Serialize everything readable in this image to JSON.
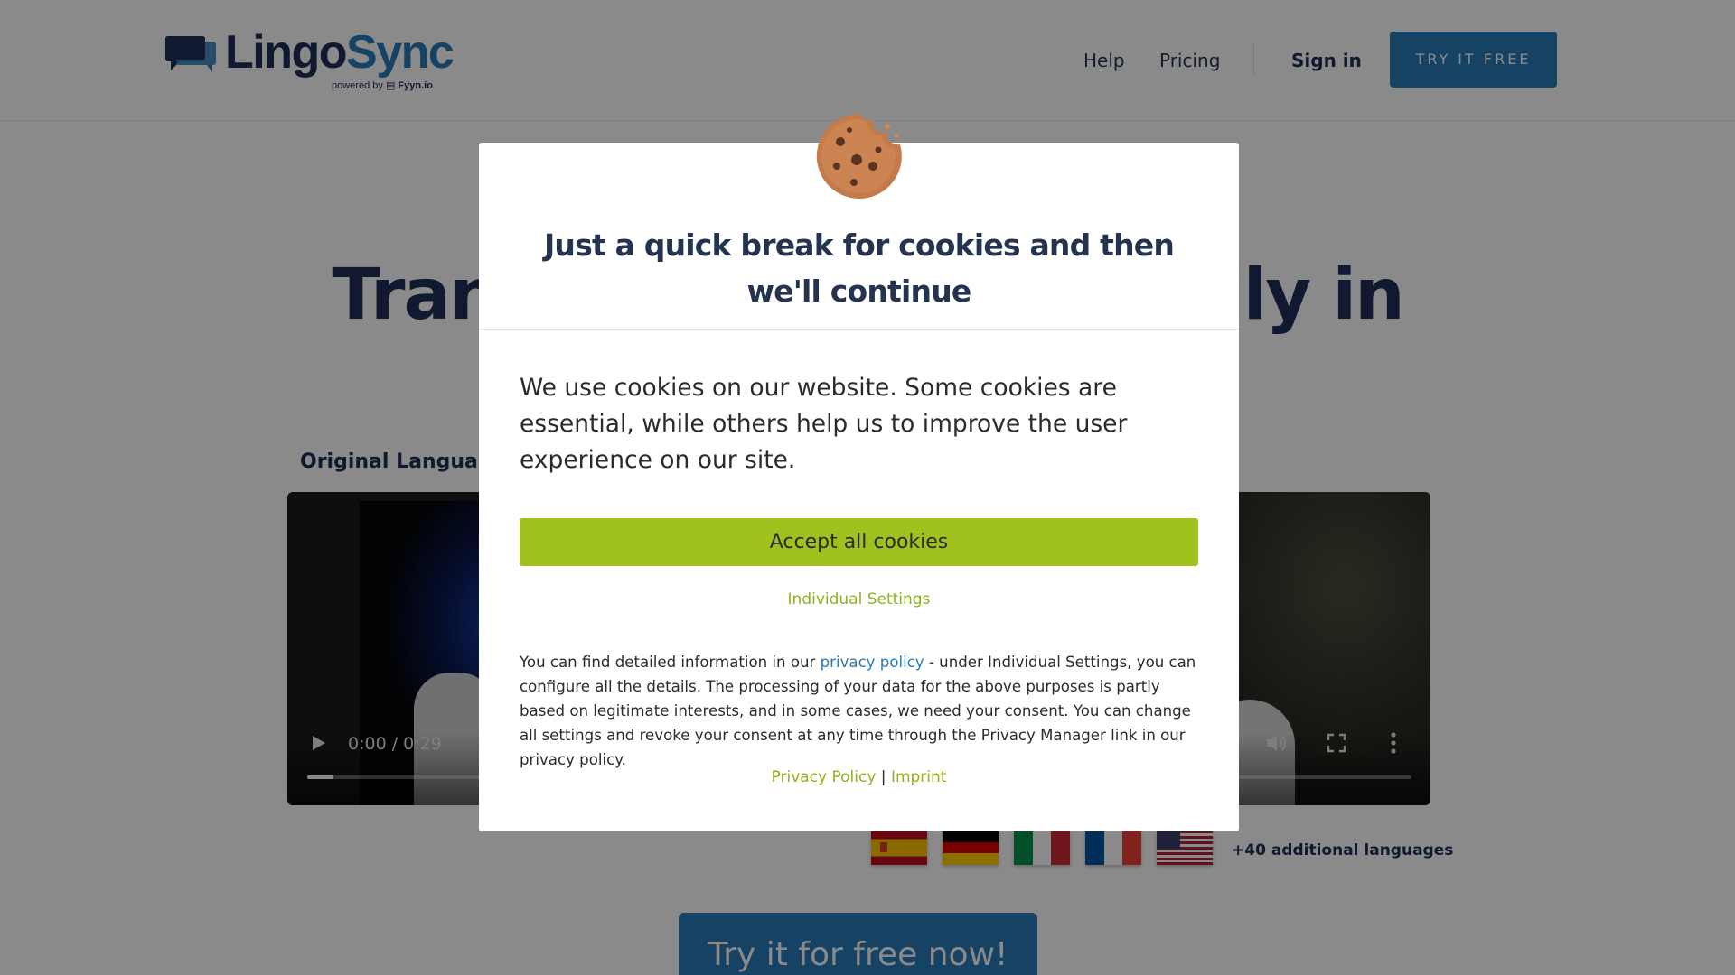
{
  "brand": {
    "name_part1": "Lingo",
    "name_part2": "Sync",
    "powered_by": "powered by",
    "powered_company": "Fyyn.io",
    "primary_color": "#1e2f57",
    "accent_color": "#2a7ab8"
  },
  "nav": {
    "help": "Help",
    "pricing": "Pricing",
    "sign_in": "Sign in",
    "try_free": "TRY IT FREE"
  },
  "hero": {
    "title_left": "Transl",
    "title_right": "asily in",
    "original_language_label": "Original Language"
  },
  "video": {
    "time": "0:00 / 0:29",
    "progress": 0.024,
    "icons": [
      "play-icon",
      "volume-icon",
      "fullscreen-icon",
      "more-options-icon"
    ]
  },
  "languages": {
    "flags": [
      "spain-flag",
      "germany-flag",
      "italy-flag",
      "france-flag",
      "usa-flag"
    ],
    "additional": "+40 additional languages"
  },
  "cta": {
    "label": "Try it for free now!"
  },
  "cookie_modal": {
    "title": "Just a quick break for cookies and then we'll continue",
    "intro": "We use cookies on our website. Some cookies are essential, while others help us to improve the user experience on our site.",
    "accept_label": "Accept all cookies",
    "individual_settings": "Individual Settings",
    "detail_before_link": "You can find detailed information in our ",
    "detail_link": "privacy policy",
    "detail_after_link": " - under Individual Settings, you can configure all the details. The processing of your data for the above purposes is partly based on legitimate interests, and in some cases, we need your consent. You can change all settings and revoke your consent at any time through the Privacy Manager link in our privacy policy.",
    "privacy_policy_link": "Privacy Policy",
    "separator": " | ",
    "imprint_link": "Imprint",
    "accept_color": "#9fc21f",
    "link_color": "#8fb41a"
  }
}
